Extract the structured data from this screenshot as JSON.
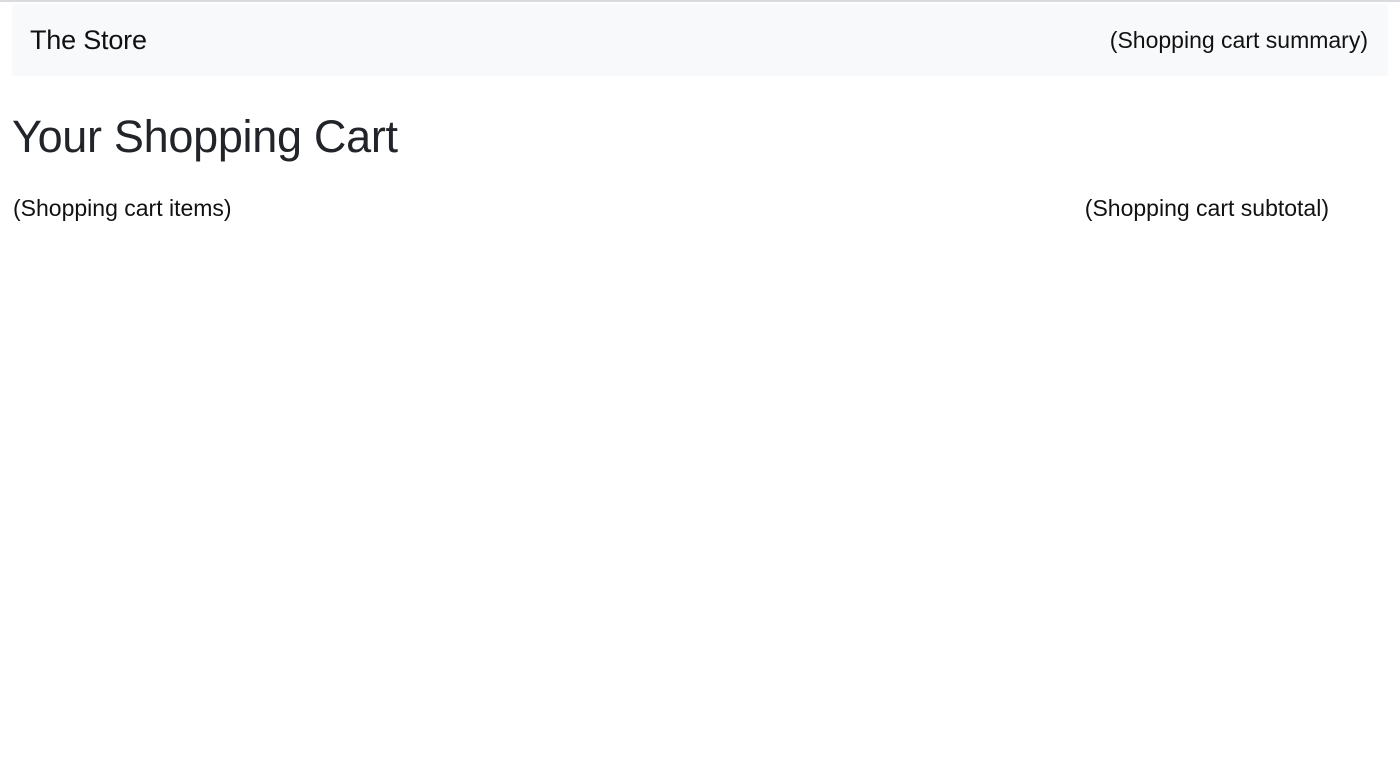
{
  "navbar": {
    "brand": "The Store",
    "cart_summary": "(Shopping cart summary)",
    "background": "#f8f9fa"
  },
  "main": {
    "title": "Your Shopping Cart",
    "cart_items": "(Shopping cart items)",
    "cart_subtotal": "(Shopping cart subtotal)"
  }
}
